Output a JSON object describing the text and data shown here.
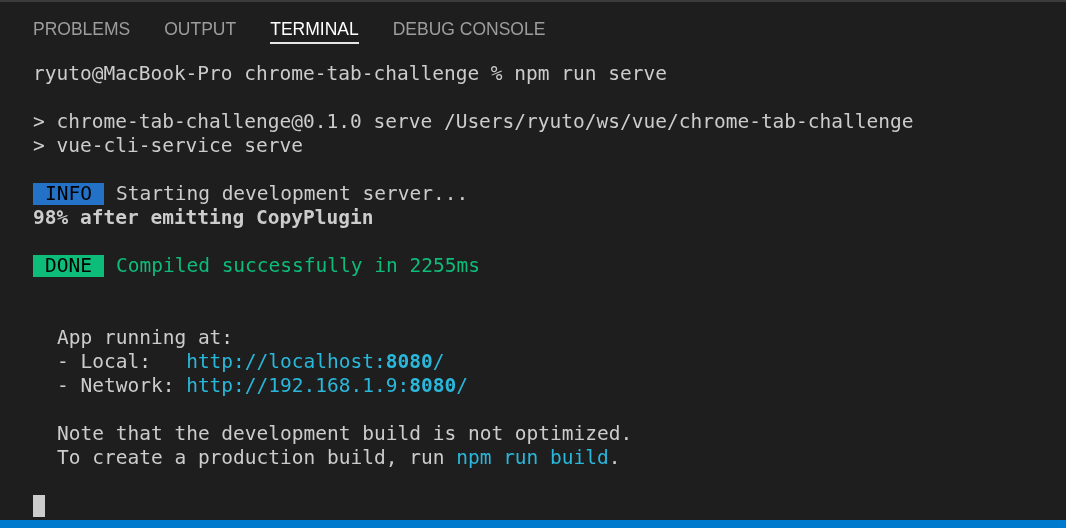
{
  "tabs": [
    {
      "label": "PROBLEMS",
      "selected": false
    },
    {
      "label": "OUTPUT",
      "selected": false
    },
    {
      "label": "TERMINAL",
      "selected": true
    },
    {
      "label": "DEBUG CONSOLE",
      "selected": false
    }
  ],
  "terminal": {
    "lines": [
      {
        "kind": "text",
        "segments": [
          {
            "kind": "plain",
            "text": "ryuto@MacBook-Pro chrome-tab-challenge % npm run serve"
          }
        ]
      },
      {
        "kind": "blank"
      },
      {
        "kind": "text",
        "segments": [
          {
            "kind": "plain",
            "text": "> chrome-tab-challenge@0.1.0 serve /Users/ryuto/ws/vue/chrome-tab-challenge"
          }
        ]
      },
      {
        "kind": "text",
        "segments": [
          {
            "kind": "plain",
            "text": "> vue-cli-service serve"
          }
        ]
      },
      {
        "kind": "blank"
      },
      {
        "kind": "text",
        "segments": [
          {
            "kind": "info",
            "text": "INFO"
          },
          {
            "kind": "plain",
            "text": "Starting development server..."
          }
        ]
      },
      {
        "kind": "text",
        "segments": [
          {
            "kind": "bold",
            "text": "98% after emitting CopyPlugin"
          }
        ]
      },
      {
        "kind": "blank"
      },
      {
        "kind": "text",
        "segments": [
          {
            "kind": "done",
            "text": "DONE"
          },
          {
            "kind": "success",
            "text": "Compiled successfully in 2255ms"
          }
        ]
      },
      {
        "kind": "blank"
      },
      {
        "kind": "blank"
      },
      {
        "kind": "text",
        "indented": true,
        "segments": [
          {
            "kind": "plain",
            "text": "App running at:"
          }
        ]
      },
      {
        "kind": "text",
        "indented": true,
        "segments": [
          {
            "kind": "plain",
            "text": "- Local:   "
          },
          {
            "kind": "link",
            "text": "http://localhost:**8080**/"
          }
        ]
      },
      {
        "kind": "text",
        "indented": true,
        "segments": [
          {
            "kind": "plain",
            "text": "- Network: "
          },
          {
            "kind": "link",
            "text": "http://192.168.1.9:**8080**/"
          }
        ]
      },
      {
        "kind": "blank"
      },
      {
        "kind": "text",
        "indented": true,
        "segments": [
          {
            "kind": "plain",
            "text": "Note that the development build is not optimized."
          }
        ]
      },
      {
        "kind": "text",
        "indented": true,
        "segments": [
          {
            "kind": "plain",
            "text": "To create a production build, run "
          },
          {
            "kind": "link",
            "text": "npm run build"
          },
          {
            "kind": "plain",
            "text": "."
          }
        ]
      },
      {
        "kind": "blank"
      },
      {
        "kind": "cursor"
      }
    ]
  }
}
